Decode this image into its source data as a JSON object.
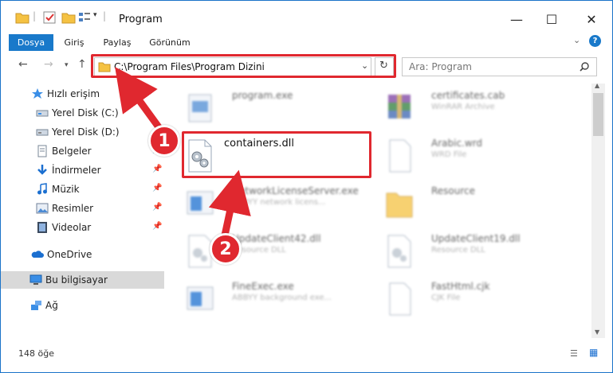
{
  "window": {
    "title": "Program",
    "accent": "#1979ca",
    "highlight_color": "#e0282f"
  },
  "ribbon": {
    "tabs": [
      "Dosya",
      "Giriş",
      "Paylaş",
      "Görünüm"
    ],
    "active_tab": "Dosya"
  },
  "address": {
    "path": "C:\\Program Files\\Program Dizini",
    "search_placeholder": "Ara: Program"
  },
  "sidebar": {
    "items": [
      {
        "label": "Hızlı erişim",
        "icon": "star-icon"
      },
      {
        "label": "Yerel Disk (C:)",
        "icon": "drive-icon"
      },
      {
        "label": "Yerel Disk (D:)",
        "icon": "drive-icon"
      },
      {
        "label": "Belgeler",
        "icon": "documents-icon"
      },
      {
        "label": "İndirmeler",
        "icon": "download-icon"
      },
      {
        "label": "Müzik",
        "icon": "music-icon"
      },
      {
        "label": "Resimler",
        "icon": "pictures-icon"
      },
      {
        "label": "Videolar",
        "icon": "video-icon"
      },
      {
        "label": "OneDrive",
        "icon": "cloud-icon"
      },
      {
        "label": "Bu bilgisayar",
        "icon": "computer-icon"
      },
      {
        "label": "Ağ",
        "icon": "network-icon"
      }
    ]
  },
  "files": [
    {
      "name": "program.exe",
      "desc": ""
    },
    {
      "name": "certificates.cab",
      "desc": "WinRAR Archive"
    },
    {
      "name": "containers.dll",
      "desc": ""
    },
    {
      "name": "Arabic.wrd",
      "desc": "WRD File"
    },
    {
      "name": "NetworkLicenseServer.exe",
      "desc": "ABBYY network licens..."
    },
    {
      "name": "Resource",
      "desc": ""
    },
    {
      "name": "UpdateClient42.dll",
      "desc": "Resource DLL"
    },
    {
      "name": "UpdateClient19.dll",
      "desc": "Resource DLL"
    },
    {
      "name": "FineExec.exe",
      "desc": "ABBYY background exe..."
    },
    {
      "name": "FastHtml.cjk",
      "desc": "CJK File"
    }
  ],
  "status": {
    "count": "148 öğe"
  },
  "callouts": [
    "1",
    "2"
  ]
}
